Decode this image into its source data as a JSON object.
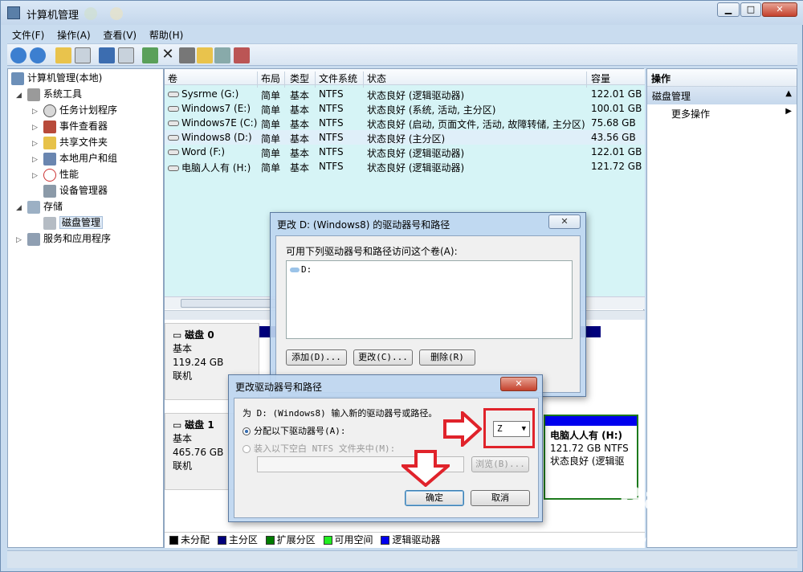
{
  "window": {
    "title": "计算机管理",
    "minimize": "▁",
    "maximize": "□",
    "close": "✕"
  },
  "menu": [
    "文件(F)",
    "操作(A)",
    "查看(V)",
    "帮助(H)"
  ],
  "tree": [
    {
      "label": "计算机管理(本地)"
    },
    {
      "label": "系统工具"
    },
    {
      "label": "任务计划程序"
    },
    {
      "label": "事件查看器"
    },
    {
      "label": "共享文件夹"
    },
    {
      "label": "本地用户和组"
    },
    {
      "label": "性能"
    },
    {
      "label": "设备管理器"
    },
    {
      "label": "存储"
    },
    {
      "label": "磁盘管理"
    },
    {
      "label": "服务和应用程序"
    }
  ],
  "volume_table": {
    "headers": [
      "卷",
      "布局",
      "类型",
      "文件系统",
      "状态",
      "容量"
    ],
    "rows": [
      {
        "vol": "Sysrme (G:)",
        "layout": "简单",
        "type": "基本",
        "fs": "NTFS",
        "status": "状态良好 (逻辑驱动器)",
        "cap": "122.01 GB"
      },
      {
        "vol": "Windows7 (E:)",
        "layout": "简单",
        "type": "基本",
        "fs": "NTFS",
        "status": "状态良好 (系统, 活动, 主分区)",
        "cap": "100.01 GB"
      },
      {
        "vol": "Windows7E (C:)",
        "layout": "简单",
        "type": "基本",
        "fs": "NTFS",
        "status": "状态良好 (启动, 页面文件, 活动, 故障转储, 主分区)",
        "cap": "75.68 GB"
      },
      {
        "vol": "Windows8 (D:)",
        "layout": "简单",
        "type": "基本",
        "fs": "NTFS",
        "status": "状态良好 (主分区)",
        "cap": "43.56 GB"
      },
      {
        "vol": "Word (F:)",
        "layout": "简单",
        "type": "基本",
        "fs": "NTFS",
        "status": "状态良好 (逻辑驱动器)",
        "cap": "122.01 GB"
      },
      {
        "vol": "电脑人人有 (H:)",
        "layout": "简单",
        "type": "基本",
        "fs": "NTFS",
        "status": "状态良好 (逻辑驱动器)",
        "cap": "121.72 GB"
      }
    ]
  },
  "disks": [
    {
      "name": "磁盘 0",
      "type": "基本",
      "size": "119.24 GB",
      "state": "联机"
    },
    {
      "name": "磁盘 1",
      "type": "基本",
      "size": "465.76 GB",
      "state": "联机"
    }
  ],
  "disk1_partition": {
    "name": "电脑人人有 (H:)",
    "size": "121.72 GB NTFS",
    "status": "状态良好 (逻辑驱"
  },
  "legend": [
    {
      "label": "未分配",
      "color": "#000000"
    },
    {
      "label": "主分区",
      "color": "#00007c"
    },
    {
      "label": "扩展分区",
      "color": "#007c00"
    },
    {
      "label": "可用空间",
      "color": "#22ee22"
    },
    {
      "label": "逻辑驱动器",
      "color": "#0000ee"
    }
  ],
  "actions": {
    "title": "操作",
    "section": "磁盘管理",
    "more": "更多操作"
  },
  "dialog1": {
    "title": "更改 D: (Windows8) 的驱动器号和路径",
    "prompt": "可用下列驱动器号和路径访问这个卷(A):",
    "entry": "D:",
    "add": "添加(D)...",
    "change": "更改(C)...",
    "delete": "删除(R)"
  },
  "dialog2": {
    "title": "更改驱动器号和路径",
    "prompt": "为 D: (Windows8) 输入新的驱动器号或路径。",
    "radio1": "分配以下驱动器号(A):",
    "radio2": "装入以下空白 NTFS 文件夹中(M):",
    "letter": "Z",
    "browse": "浏览(B)...",
    "ok": "确定",
    "cancel": "取消"
  },
  "watermark": {
    "brand": "Baidu",
    "cn": "经验",
    "url": "jingyan.baidu.com"
  }
}
